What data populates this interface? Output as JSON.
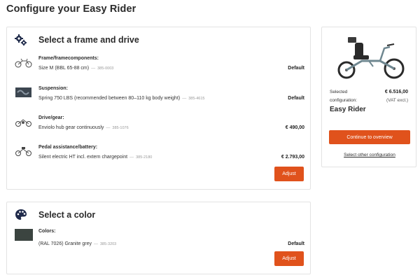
{
  "page_title": "Configure your Easy Rider",
  "frame_section": {
    "title": "Select a frame and drive",
    "icon": "gears-icon",
    "rows": [
      {
        "label": "Frame/framecomponents:",
        "value": "Size M (BBL 65-88 cm)",
        "code": "385-0003",
        "price": "Default"
      },
      {
        "label": "Suspension:",
        "value": "Spring 750 LBS (recommended between 80–110 kg body weight)",
        "code": "385-4615",
        "price": "Default"
      },
      {
        "label": "Drive/gear:",
        "value": "Enviolo hub gear continuously",
        "code": "385-1076",
        "price": "€ 490,00"
      },
      {
        "label": "Pedal assistance/battery:",
        "value": "Silent electric HT incl. extern chargepoint",
        "code": "385-2180",
        "price": "€ 2.793,00"
      }
    ],
    "adjust_label": "Adjust"
  },
  "color_section": {
    "title": "Select a color",
    "icon": "palette-icon",
    "row": {
      "label": "Colors:",
      "value": "(RAL 7026) Granite grey",
      "code": "385-3203",
      "price": "Default"
    },
    "swatch_color": "#3b4440",
    "adjust_label": "Adjust"
  },
  "summary": {
    "selected_label": "Selected",
    "configuration_label": "configuration:",
    "price": "€ 6.516,00",
    "vat_note": "(VAT excl.)",
    "model": "Easy Rider",
    "continue_label": "Continue to overview",
    "other_link": "Select other configuration"
  },
  "colors": {
    "accent": "#e0521c",
    "icon_navy": "#1f2a4a"
  }
}
